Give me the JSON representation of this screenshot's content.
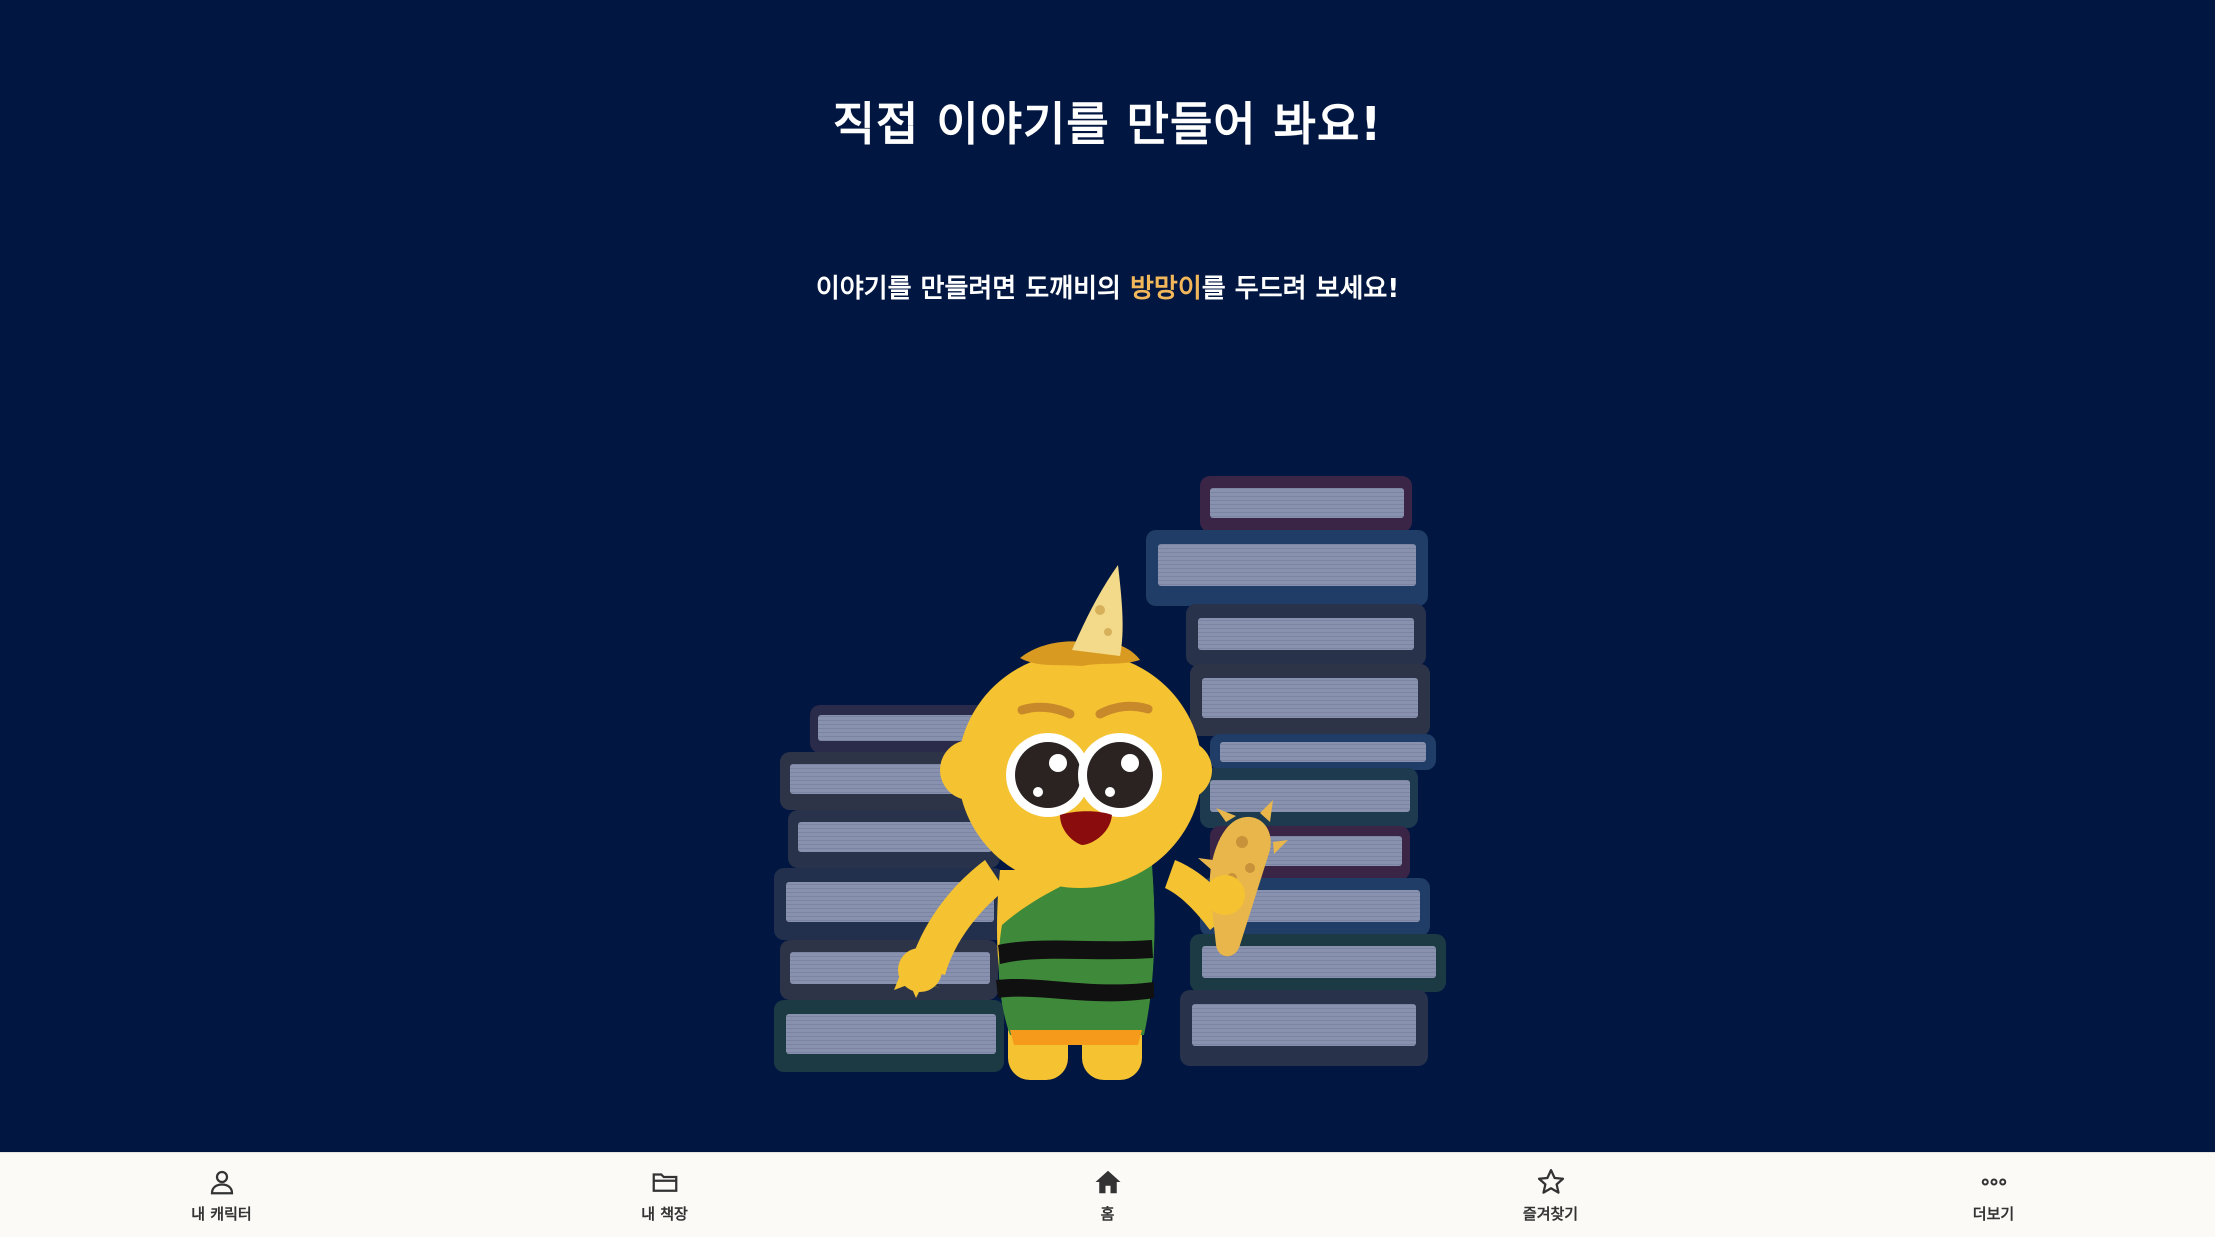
{
  "header": {
    "title": "직접 이야기를 만들어 봐요!",
    "subtitle_before": "이야기를 만들려면 도깨비의 ",
    "subtitle_highlight": "방망이",
    "subtitle_after": "를 두드려 보세요!"
  },
  "colors": {
    "background": "#011640",
    "highlight": "#f2b75b",
    "nav_background": "#fbfaf7"
  },
  "nav": {
    "items": [
      {
        "label": "내 캐릭터",
        "icon": "person-icon"
      },
      {
        "label": "내 책장",
        "icon": "folder-icon"
      },
      {
        "label": "홈",
        "icon": "home-icon"
      },
      {
        "label": "즐겨찾기",
        "icon": "star-icon"
      },
      {
        "label": "더보기",
        "icon": "more-dots-icon"
      }
    ]
  }
}
